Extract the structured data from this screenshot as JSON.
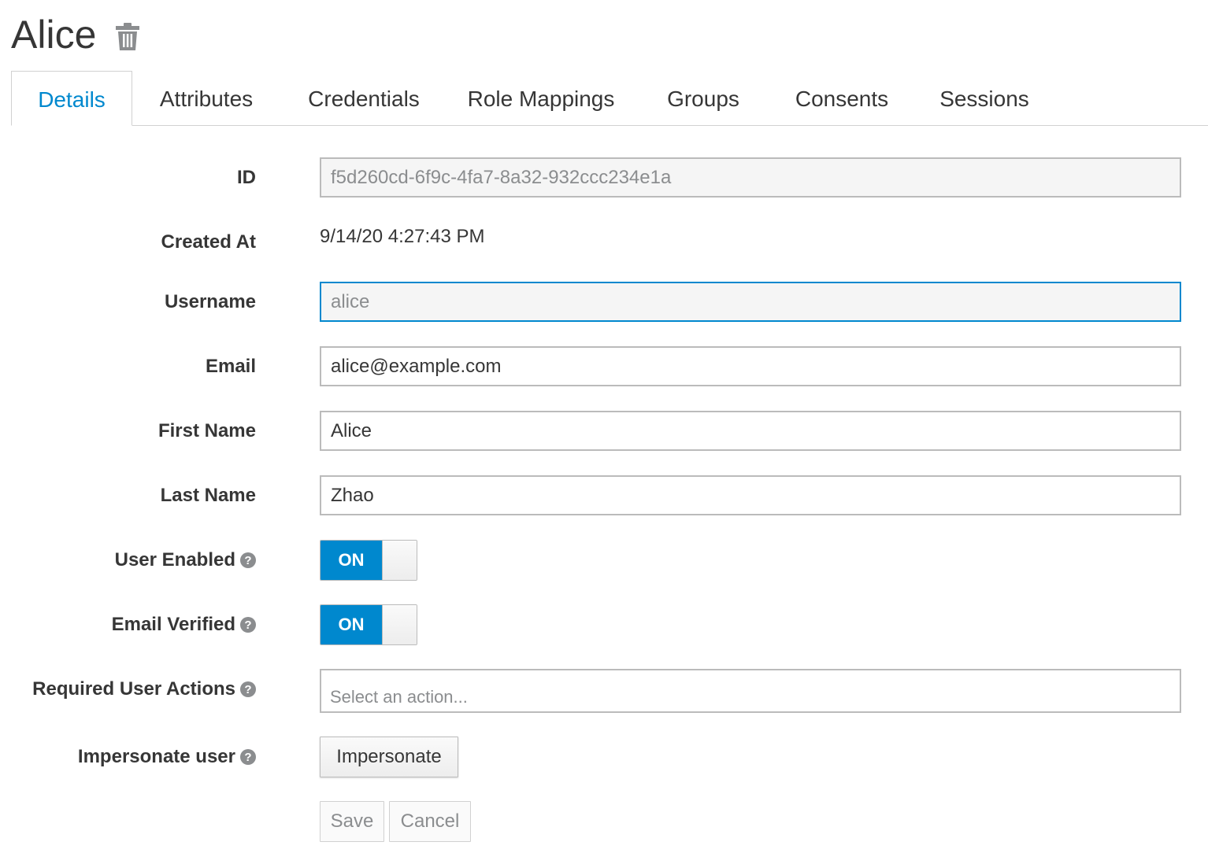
{
  "header": {
    "title": "Alice",
    "delete_icon": "trash-icon"
  },
  "tabs": [
    {
      "label": "Details",
      "active": true
    },
    {
      "label": "Attributes"
    },
    {
      "label": "Credentials"
    },
    {
      "label": "Role Mappings"
    },
    {
      "label": "Groups"
    },
    {
      "label": "Consents"
    },
    {
      "label": "Sessions"
    }
  ],
  "form": {
    "id": {
      "label": "ID",
      "value": "f5d260cd-6f9c-4fa7-8a32-932ccc234e1a"
    },
    "created_at": {
      "label": "Created At",
      "value": "9/14/20 4:27:43 PM"
    },
    "username": {
      "label": "Username",
      "value": "alice"
    },
    "email": {
      "label": "Email",
      "value": "alice@example.com"
    },
    "first_name": {
      "label": "First Name",
      "value": "Alice"
    },
    "last_name": {
      "label": "Last Name",
      "value": "Zhao"
    },
    "user_enabled": {
      "label": "User Enabled",
      "state": "ON"
    },
    "email_verified": {
      "label": "Email Verified",
      "state": "ON"
    },
    "required_actions": {
      "label": "Required User Actions",
      "placeholder": "Select an action..."
    },
    "impersonate": {
      "label": "Impersonate user",
      "button": "Impersonate"
    },
    "help_icon": "question-circle-icon"
  },
  "actions": {
    "save": "Save",
    "cancel": "Cancel"
  },
  "colors": {
    "accent": "#0088ce",
    "text": "#363636",
    "muted": "#8b8d8f",
    "border": "#bbbbbb"
  }
}
